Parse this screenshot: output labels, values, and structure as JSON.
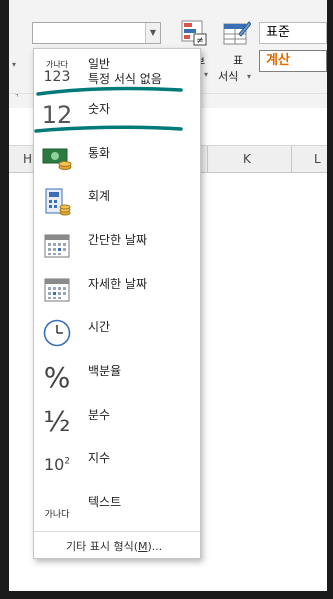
{
  "ribbon": {
    "number_format_value": "",
    "conditional_label": "부",
    "table_format_label_top": "표",
    "table_format_label_bottom": "서식",
    "style_normal": "표준",
    "style_calc": "계산",
    "not_equal_glyph": "≠"
  },
  "columns": [
    "H",
    "K",
    "L"
  ],
  "menu": {
    "items": [
      {
        "label": "일반",
        "sublabel": "특정 서식 없음",
        "icon": "general-format-icon",
        "icon_text_top": "가나다",
        "icon_text_bottom": "123"
      },
      {
        "label": "숫자",
        "icon": "number-format-icon",
        "icon_text": "12"
      },
      {
        "label": "통화",
        "icon": "currency-icon"
      },
      {
        "label": "회계",
        "icon": "accounting-icon"
      },
      {
        "label": "간단한 날짜",
        "icon": "short-date-icon"
      },
      {
        "label": "자세한 날짜",
        "icon": "long-date-icon"
      },
      {
        "label": "시간",
        "icon": "clock-icon"
      },
      {
        "label": "백분율",
        "icon": "percent-icon",
        "icon_text": "%"
      },
      {
        "label": "분수",
        "icon": "fraction-icon",
        "icon_text": "½"
      },
      {
        "label": "지수",
        "icon": "scientific-icon",
        "icon_text_base": "10",
        "icon_text_exp": "2"
      },
      {
        "label": "텍스트",
        "icon": "text-format-icon",
        "icon_text": "가나다"
      }
    ],
    "footer_prefix": "기타 표시 형식(",
    "footer_key": "M",
    "footer_suffix": ")..."
  },
  "colors": {
    "highlight_stroke": "#007a78",
    "calc_style_text": "#e06a00",
    "currency_green": "#2b7a3f",
    "icon_blue": "#3a6fb5",
    "coin_gold": "#e2a93b"
  }
}
